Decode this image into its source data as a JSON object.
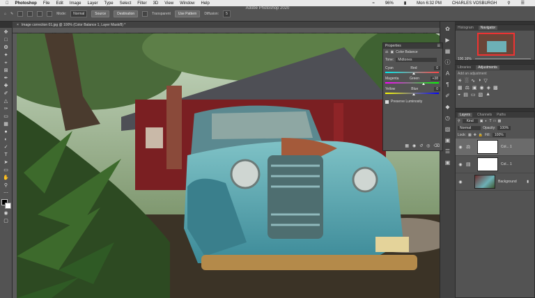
{
  "menubar": {
    "apple": "",
    "items": [
      "Photoshop",
      "File",
      "Edit",
      "Image",
      "Layer",
      "Type",
      "Select",
      "Filter",
      "3D",
      "View",
      "Window",
      "Help"
    ],
    "battery": "96%",
    "clock": "Mon 6:32 PM",
    "user": "CHARLES VOSBURGH"
  },
  "window_title": "Adobe Photoshop 2020",
  "options": {
    "brush_size": "9",
    "mode_label": "Mode:",
    "mode_value": "Normal",
    "source_btn": "Source",
    "destination_btn": "Destination",
    "transparent_label": "Transparent",
    "use_pattern_btn": "Use Pattern",
    "diffusion_label": "Diffusion:",
    "diffusion_value": "5"
  },
  "document_tab": "Image correction 01.jpg @ 100% (Color Balance 1, Layer Mask/8) *",
  "ruler_ticks": [
    "80",
    "90",
    "100",
    "110",
    "120",
    "130",
    "140",
    "150",
    "160",
    "170",
    "180",
    "190",
    "200",
    "210",
    "220",
    "230",
    "240",
    "250",
    "260",
    "270",
    "280",
    "290",
    "300",
    "310",
    "320",
    "330",
    "340",
    "350",
    "360",
    "370",
    "380",
    "390",
    "400",
    "410",
    "420",
    "430",
    "440",
    "450",
    "460",
    "470",
    "480",
    "490",
    "500",
    "510",
    "520",
    "530",
    "540",
    "550",
    "560",
    "570",
    "580",
    "590",
    "600",
    "610",
    "620",
    "630",
    "640",
    "650",
    "660",
    "670",
    "680",
    "690",
    "700",
    "710",
    "720",
    "730",
    "740",
    "750",
    "760"
  ],
  "properties": {
    "title": "Properties",
    "subtitle": "Color Balance",
    "tone_label": "Tone:",
    "tone_value": "Midtones",
    "cyan": "Cyan",
    "red": "Red",
    "cyan_value": "0",
    "magenta": "Magenta",
    "green": "Green",
    "magenta_value": "+38",
    "yellow": "Yellow",
    "blue": "Blue",
    "yellow_value": "0",
    "preserve": "Preserve Luminosity",
    "cyan_red": 0.5,
    "magenta_green": 0.69,
    "yellow_blue": 0.5
  },
  "navigator": {
    "tab1": "Histogram",
    "tab2": "Navigator",
    "zoom": "100.16%"
  },
  "adjustments": {
    "tab1": "Libraries",
    "tab2": "Adjustments",
    "hint": "Add an adjustment"
  },
  "layers": {
    "tab1": "Layers",
    "tab2": "Channels",
    "tab3": "Paths",
    "kind": "Kind",
    "blend": "Normal",
    "opacity_label": "Opacity:",
    "opacity": "100%",
    "lock_label": "Lock:",
    "fill_label": "Fill:",
    "fill": "100%",
    "rows": [
      {
        "name": "Col... 1",
        "selected": true
      },
      {
        "name": "Col... 1",
        "selected": false
      },
      {
        "name": "Background",
        "selected": false
      }
    ]
  },
  "colors": {
    "accent": "#1473e6",
    "bg": "#323232",
    "panel": "#535353"
  }
}
